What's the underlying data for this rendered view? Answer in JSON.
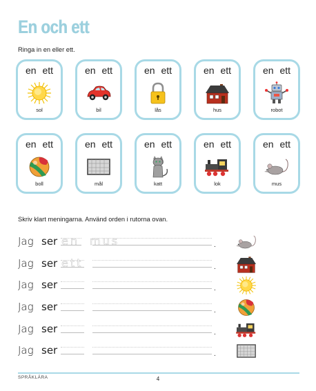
{
  "title": "En och ett",
  "instruction1": "Ringa in en eller ett.",
  "cards": [
    {
      "words": "en ett",
      "label": "sol",
      "icon": "sun-icon"
    },
    {
      "words": "en ett",
      "label": "bil",
      "icon": "car-icon"
    },
    {
      "words": "en ett",
      "label": "lås",
      "icon": "padlock-icon"
    },
    {
      "words": "en ett",
      "label": "hus",
      "icon": "house-icon"
    },
    {
      "words": "en ett",
      "label": "robot",
      "icon": "robot-icon"
    },
    {
      "words": "en ett",
      "label": "boll",
      "icon": "ball-icon"
    },
    {
      "words": "en ett",
      "label": "mål",
      "icon": "goal-icon"
    },
    {
      "words": "en ett",
      "label": "katt",
      "icon": "cat-icon"
    },
    {
      "words": "en ett",
      "label": "lok",
      "icon": "locomotive-icon"
    },
    {
      "words": "en ett",
      "label": "mus",
      "icon": "mouse-icon"
    }
  ],
  "instruction2": "Skriv klart meningarna. Använd orden i rutorna ovan.",
  "sentences": [
    {
      "jag": "Jag",
      "ser": "ser",
      "ghost1": "en",
      "ghost2": "mus",
      "end": ".",
      "icon": "mouse-icon"
    },
    {
      "jag": "Jag",
      "ser": "ser",
      "ghost1": "ett",
      "ghost2": "",
      "end": ".",
      "icon": "house-icon"
    },
    {
      "jag": "Jag",
      "ser": "ser",
      "ghost1": "",
      "ghost2": "",
      "end": ".",
      "icon": "sun-icon"
    },
    {
      "jag": "Jag",
      "ser": "ser",
      "ghost1": "",
      "ghost2": "",
      "end": ".",
      "icon": "ball-icon"
    },
    {
      "jag": "Jag",
      "ser": "ser",
      "ghost1": "",
      "ghost2": "",
      "end": ".",
      "icon": "locomotive-icon"
    },
    {
      "jag": "Jag",
      "ser": "ser",
      "ghost1": "",
      "ghost2": "",
      "end": ".",
      "icon": "goal-icon"
    }
  ],
  "footer": {
    "section": "SPRÅKLÄRA",
    "page": "4"
  },
  "colors": {
    "accent": "#9cd0de",
    "card_border": "#a8d9e6"
  }
}
